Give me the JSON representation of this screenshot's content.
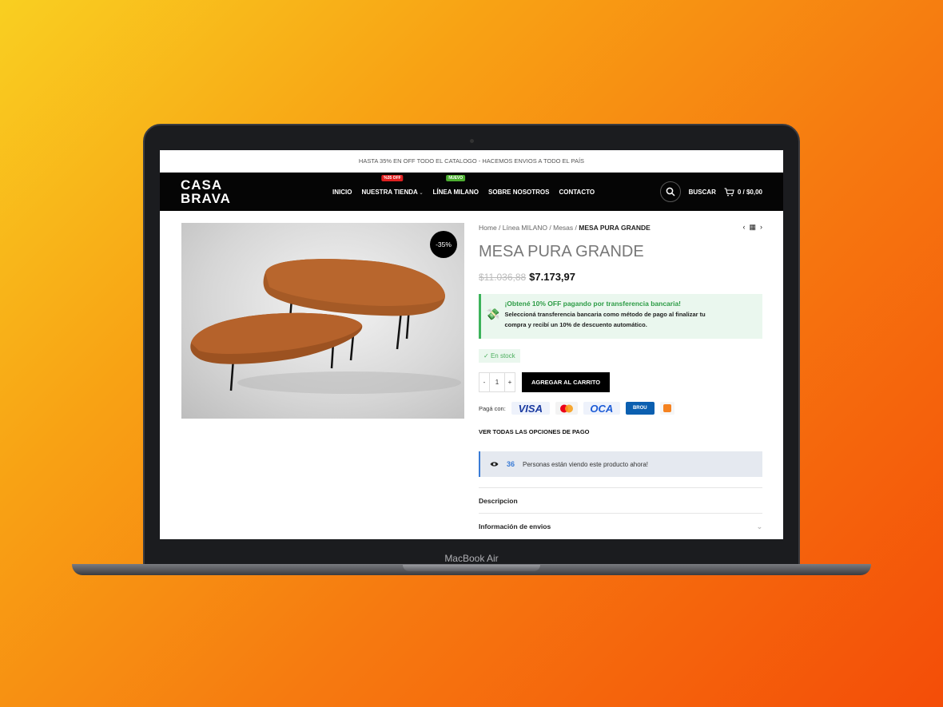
{
  "device": {
    "label": "MacBook Air"
  },
  "topbar": {
    "text": "HASTA 35% EN OFF TODO EL CATALOGO - HACEMOS ENVIOS A TODO EL PAÍS"
  },
  "header": {
    "logo_line1": "CASA",
    "logo_line2": "BRAVA",
    "nav": [
      {
        "label": "INICIO",
        "badge": null
      },
      {
        "label": "NUESTRA TIENDA",
        "badge": "%35 OFF",
        "badge_color": "#e02020",
        "dropdown": true
      },
      {
        "label": "LÍNEA MILANO",
        "badge": "NUEVO",
        "badge_color": "#4caf30"
      },
      {
        "label": "SOBRE NOSOTROS",
        "badge": null
      },
      {
        "label": "CONTACTO",
        "badge": null
      }
    ],
    "search_label": "BUSCAR",
    "cart_label": "0 / $0,00"
  },
  "breadcrumb": {
    "home": "Home",
    "line": "Línea MILANO",
    "category": "Mesas",
    "current": "MESA PURA GRANDE"
  },
  "product": {
    "title": "MESA PURA GRANDE",
    "discount_badge": "-35%",
    "old_price": "$11.036,88",
    "price": "$7.173,97",
    "promo_title": "¡Obtené 10% OFF pagando por transferencia bancaria!",
    "promo_line1": "Seleccioná transferencia bancaria como método de pago al finalizar tu",
    "promo_line2": "compra y recibí un 10% de descuento automático.",
    "stock": "En stock",
    "qty_minus": "-",
    "qty_value": "1",
    "qty_plus": "+",
    "add_to_cart": "AGREGAR AL CARRITO",
    "pay_with": "Pagá con:",
    "pay_visa": "VISA",
    "pay_oca": "OCA",
    "pay_brou": "BROU",
    "all_payment_options": "VER TODAS LAS OPCIONES DE PAGO",
    "viewing_count": "36",
    "viewing_text": "Personas están viendo este producto ahora!",
    "tab_description": "Descripcion",
    "tab_shipping": "Información de envios"
  },
  "colors": {
    "accent_green": "#3cb35a",
    "whatsapp": "#25c95f",
    "info_blue": "#3a7bd5"
  }
}
